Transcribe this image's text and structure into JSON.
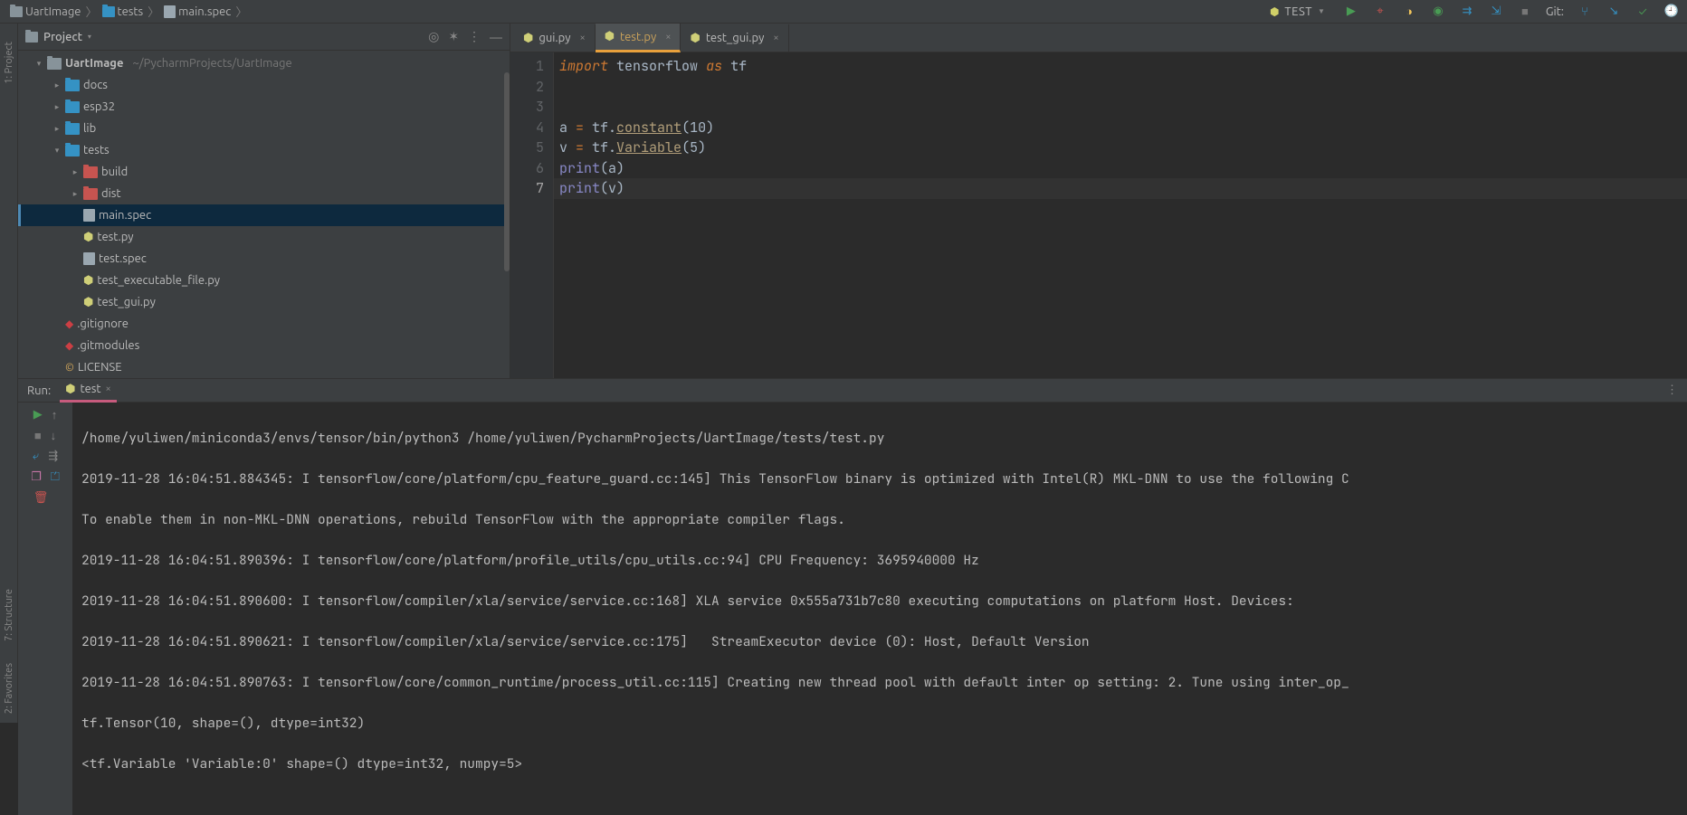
{
  "breadcrumbs": {
    "project": "UartImage",
    "folder": "tests",
    "file": "main.spec"
  },
  "toolbar": {
    "run_config": "TEST",
    "git_label": "Git:"
  },
  "side_tabs": {
    "project": "1: Project",
    "structure": "7: Structure",
    "favorites": "2: Favorites"
  },
  "project_panel": {
    "title": "Project",
    "root": "UartImage",
    "root_path": "~/PycharmProjects/UartImage",
    "items": [
      {
        "name": "docs"
      },
      {
        "name": "esp32"
      },
      {
        "name": "lib"
      },
      {
        "name": "tests"
      },
      {
        "name": "build"
      },
      {
        "name": "dist"
      },
      {
        "name": "main.spec"
      },
      {
        "name": "test.py"
      },
      {
        "name": "test.spec"
      },
      {
        "name": "test_executable_file.py"
      },
      {
        "name": "test_gui.py"
      },
      {
        "name": ".gitignore"
      },
      {
        "name": ".gitmodules"
      },
      {
        "name": "LICENSE"
      }
    ]
  },
  "editor": {
    "tabs": [
      {
        "name": "gui.py"
      },
      {
        "name": "test.py"
      },
      {
        "name": "test_gui.py"
      }
    ],
    "active_tab": 1,
    "code": {
      "l1_import": "import",
      "l1_tf": "tensorflow",
      "l1_as": "as",
      "l1_alias": "tf",
      "l4_a": "a",
      "l4_eq": " = ",
      "l4_tf": "tf.",
      "l4_fn": "constant",
      "l4_arg": "(10)",
      "l5_v": "v",
      "l5_eq": " = ",
      "l5_tf": "tf.",
      "l5_fn": "Variable",
      "l5_arg": "(5)",
      "l6_print": "print",
      "l6_arg": "(a)",
      "l7_print": "print",
      "l7_arg": "(v)"
    },
    "line_numbers": [
      "1",
      "2",
      "3",
      "4",
      "5",
      "6",
      "7"
    ]
  },
  "run": {
    "title": "Run:",
    "tab": "test",
    "lines": [
      "/home/yuliwen/miniconda3/envs/tensor/bin/python3 /home/yuliwen/PycharmProjects/UartImage/tests/test.py",
      "2019-11-28 16:04:51.884345: I tensorflow/core/platform/cpu_feature_guard.cc:145] This TensorFlow binary is optimized with Intel(R) MKL-DNN to use the following C",
      "To enable them in non-MKL-DNN operations, rebuild TensorFlow with the appropriate compiler flags.",
      "2019-11-28 16:04:51.890396: I tensorflow/core/platform/profile_utils/cpu_utils.cc:94] CPU Frequency: 3695940000 Hz",
      "2019-11-28 16:04:51.890600: I tensorflow/compiler/xla/service/service.cc:168] XLA service 0x555a731b7c80 executing computations on platform Host. Devices:",
      "2019-11-28 16:04:51.890621: I tensorflow/compiler/xla/service/service.cc:175]   StreamExecutor device (0): Host, Default Version",
      "2019-11-28 16:04:51.890763: I tensorflow/core/common_runtime/process_util.cc:115] Creating new thread pool with default inter op setting: 2. Tune using inter_op_",
      "tf.Tensor(10, shape=(), dtype=int32)",
      "<tf.Variable 'Variable:0' shape=() dtype=int32, numpy=5>"
    ]
  }
}
